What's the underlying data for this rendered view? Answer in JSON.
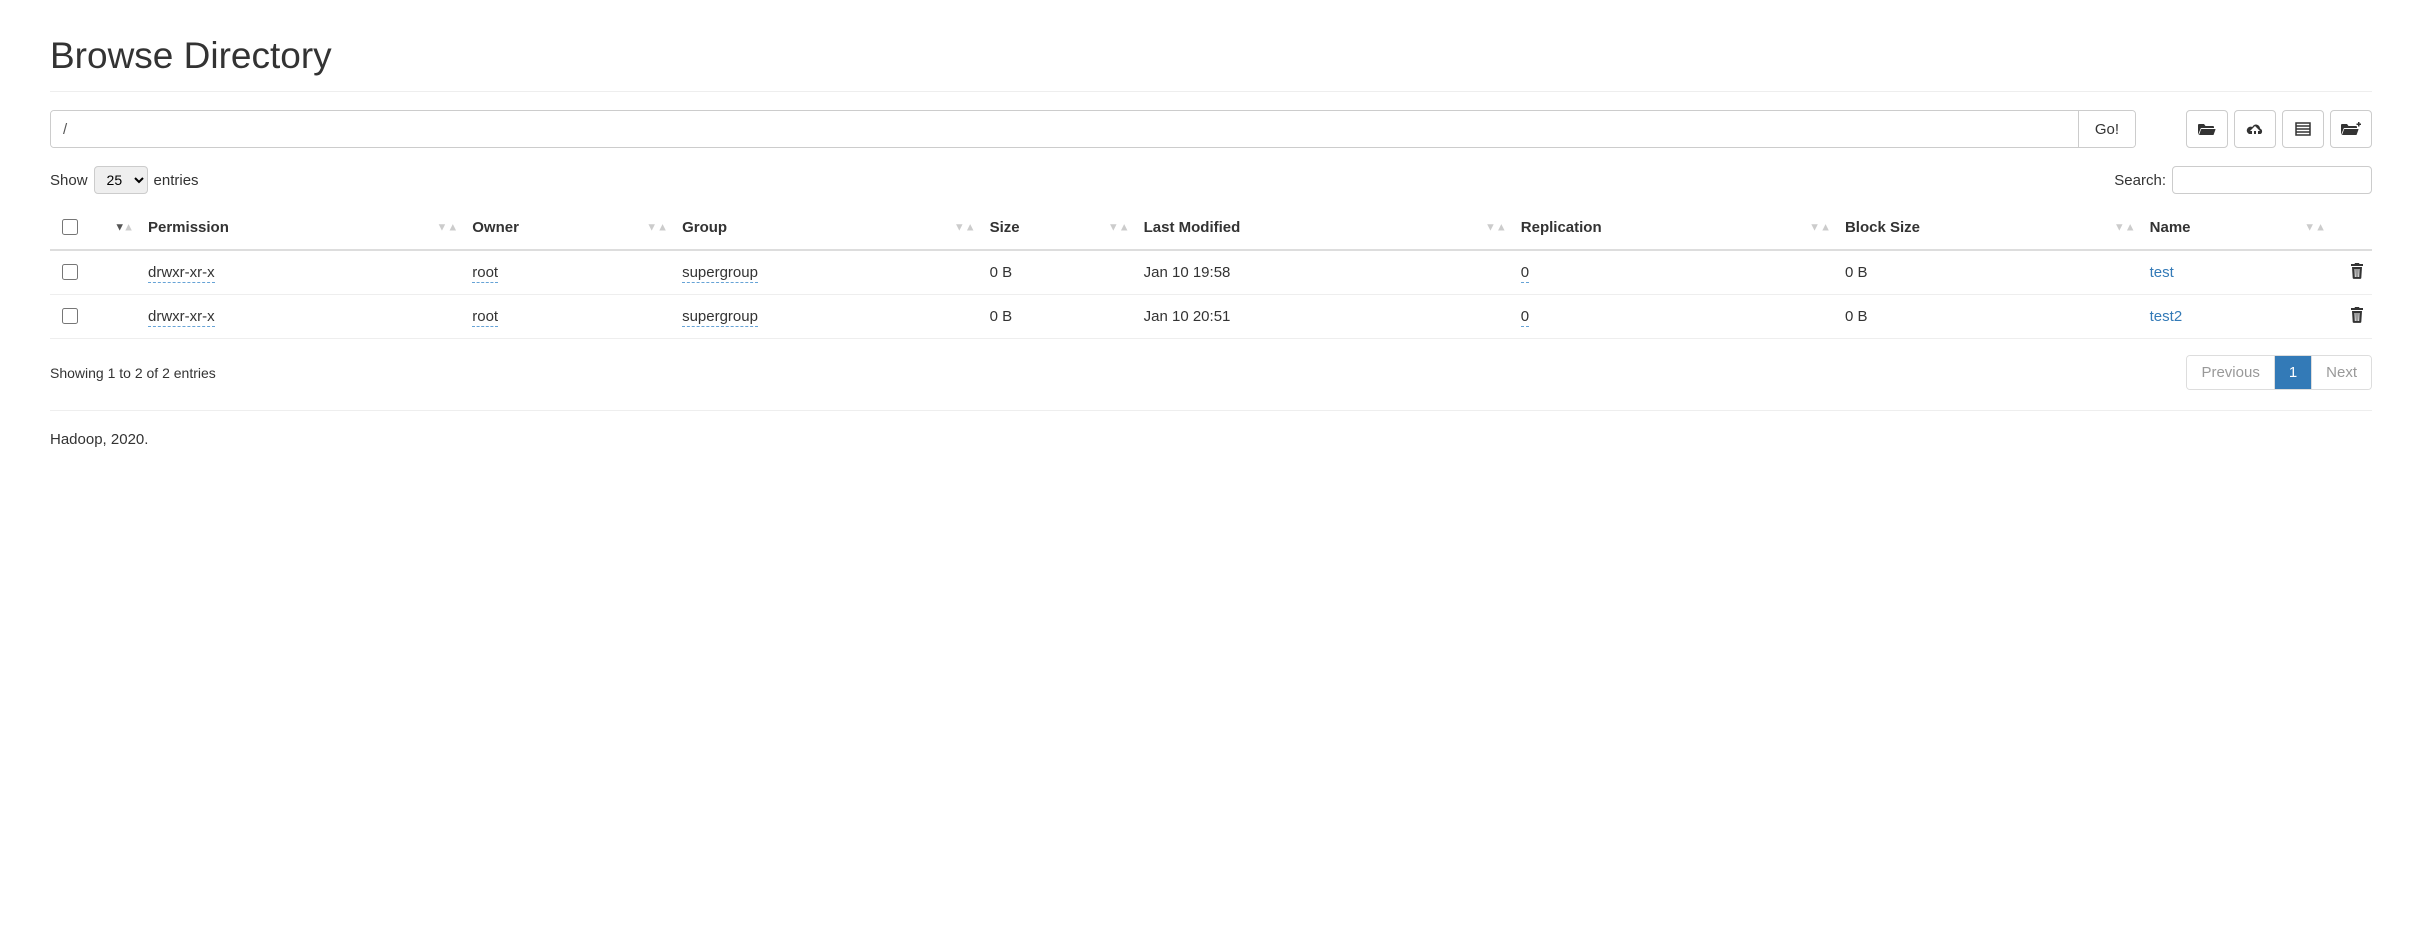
{
  "page_title": "Browse Directory",
  "path_input_value": "/",
  "go_label": "Go!",
  "show_label_pre": "Show",
  "show_label_post": "entries",
  "show_value": "25",
  "search_label": "Search:",
  "columns": {
    "permission": "Permission",
    "owner": "Owner",
    "group": "Group",
    "size": "Size",
    "last_modified": "Last Modified",
    "replication": "Replication",
    "block_size": "Block Size",
    "name": "Name"
  },
  "rows": [
    {
      "permission": "drwxr-xr-x",
      "owner": "root",
      "group": "supergroup",
      "size": "0 B",
      "last_modified": "Jan 10 19:58",
      "replication": "0",
      "block_size": "0 B",
      "name": "test"
    },
    {
      "permission": "drwxr-xr-x",
      "owner": "root",
      "group": "supergroup",
      "size": "0 B",
      "last_modified": "Jan 10 20:51",
      "replication": "0",
      "block_size": "0 B",
      "name": "test2"
    }
  ],
  "info_text": "Showing 1 to 2 of 2 entries",
  "pagination": {
    "previous": "Previous",
    "page": "1",
    "next": "Next"
  },
  "footer": "Hadoop, 2020.",
  "icons": {
    "open_folder": "folder-open-icon",
    "upload": "upload-icon",
    "cut": "list-icon",
    "new_folder": "new-folder-icon",
    "trash": "trash-icon"
  }
}
